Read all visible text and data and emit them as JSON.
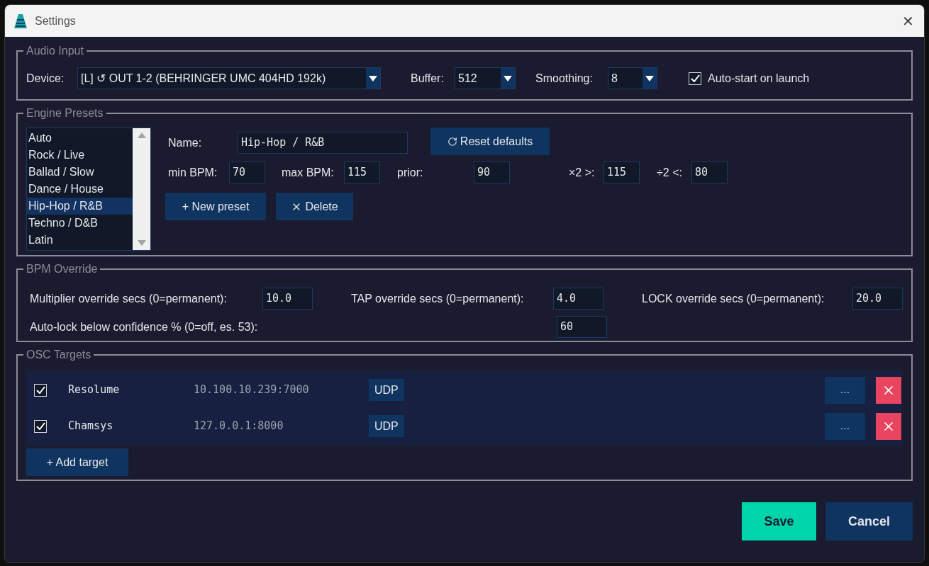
{
  "window": {
    "title": "Settings",
    "close": "✕"
  },
  "audio_input": {
    "title": "Audio Input",
    "device": {
      "label": "Device:",
      "value": "[L] ↺ OUT 1-2 (BEHRINGER UMC 404HD 192k)"
    },
    "buffer": {
      "label": "Buffer:",
      "value": "512"
    },
    "smoothing": {
      "label": "Smoothing:",
      "value": "8"
    },
    "auto_start": {
      "label": "Auto-start on launch",
      "checked": true
    }
  },
  "engine_presets": {
    "title": "Engine Presets",
    "presets": [
      {
        "label": "Auto",
        "selected": false
      },
      {
        "label": "Rock / Live",
        "selected": false
      },
      {
        "label": "Ballad / Slow",
        "selected": false
      },
      {
        "label": "Dance / House",
        "selected": false
      },
      {
        "label": "Hip-Hop / R&B",
        "selected": true
      },
      {
        "label": "Techno / D&B",
        "selected": false
      },
      {
        "label": "Latin",
        "selected": false
      }
    ],
    "name": {
      "label": "Name:",
      "value": "Hip-Hop / R&B"
    },
    "reset_button": "Reset defaults",
    "fields": [
      {
        "label": "min BPM:",
        "value": "70"
      },
      {
        "label": "max BPM:",
        "value": "115"
      },
      {
        "label": "prior:",
        "value": "90"
      },
      {
        "label": "×2 >:",
        "value": "115"
      },
      {
        "label": "÷2 <:",
        "value": "80"
      }
    ],
    "new_button": "+ New preset",
    "delete_button": "Delete"
  },
  "bpm_override": {
    "title": "BPM Override",
    "fields": [
      {
        "label": "Multiplier override secs (0=permanent):",
        "value": "10.0"
      },
      {
        "label": "TAP override secs (0=permanent):",
        "value": "4.0"
      },
      {
        "label": "LOCK override secs (0=permanent):",
        "value": "20.0"
      },
      {
        "label": "Auto-lock below confidence % (0=off, es. 53):",
        "value": "60"
      }
    ]
  },
  "osc_targets": {
    "title": "OSC Targets",
    "targets": [
      {
        "enabled": true,
        "name": "Resolume",
        "address": "10.100.10.239:7000",
        "protocol": "UDP",
        "more": "…"
      },
      {
        "enabled": true,
        "name": "Chamsys",
        "address": "127.0.0.1:8000",
        "protocol": "UDP",
        "more": "…"
      }
    ],
    "add_button": "+ Add target"
  },
  "buttons": [
    {
      "label": "Save",
      "kind": "primary"
    },
    {
      "label": "Cancel",
      "kind": "secondary"
    }
  ]
}
